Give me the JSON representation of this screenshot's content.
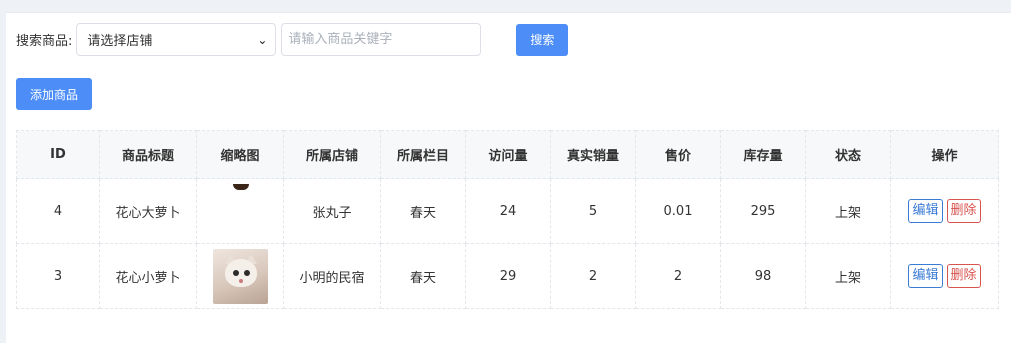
{
  "search": {
    "label": "搜索商品:",
    "shop_select_value": "请选择店铺",
    "keyword_placeholder": "请输入商品关键字",
    "button_label": "搜索"
  },
  "add_button_label": "添加商品",
  "table": {
    "headers": [
      "ID",
      "商品标题",
      "缩略图",
      "所属店铺",
      "所属栏目",
      "访问量",
      "真实销量",
      "售价",
      "库存量",
      "状态",
      "操作"
    ],
    "rows": [
      {
        "id": "4",
        "title": "花心大萝卜",
        "shop": "张丸子",
        "column": "春天",
        "visits": "24",
        "sales": "5",
        "price": "0.01",
        "stock": "295",
        "status": "上架",
        "edit_label": "编辑",
        "delete_label": "删除"
      },
      {
        "id": "3",
        "title": "花心小萝卜",
        "shop": "小明的民宿",
        "column": "春天",
        "visits": "29",
        "sales": "2",
        "price": "2",
        "stock": "98",
        "status": "上架",
        "edit_label": "编辑",
        "delete_label": "删除"
      }
    ]
  },
  "colors": {
    "primary": "#4d8df7",
    "edit": "#3a7bd5",
    "delete": "#d9534f"
  }
}
